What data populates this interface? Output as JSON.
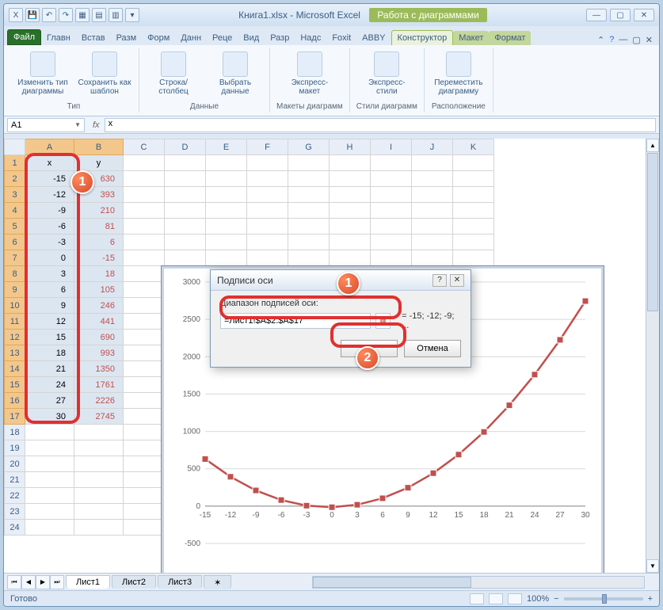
{
  "window": {
    "title": "Книга1.xlsx - Microsoft Excel",
    "chart_tools": "Работа с диаграммами"
  },
  "tabs": {
    "file": "Файл",
    "items": [
      "Главн",
      "Встав",
      "Разм",
      "Форм",
      "Данн",
      "Реце",
      "Вид",
      "Разр",
      "Надс",
      "Foxit",
      "ABBY"
    ],
    "ctx": [
      "Конструктор",
      "Макет",
      "Формат"
    ]
  },
  "ribbon": {
    "groups": [
      {
        "label": "Тип",
        "buttons": [
          "Изменить тип диаграммы",
          "Сохранить как шаблон"
        ]
      },
      {
        "label": "Данные",
        "buttons": [
          "Строка/столбец",
          "Выбрать данные"
        ]
      },
      {
        "label": "Макеты диаграмм",
        "buttons": [
          "Экспресс-макет"
        ]
      },
      {
        "label": "Стили диаграмм",
        "buttons": [
          "Экспресс-стили"
        ]
      },
      {
        "label": "Расположение",
        "buttons": [
          "Переместить диаграмму"
        ]
      }
    ]
  },
  "formula_bar": {
    "name_box": "A1",
    "fx_label": "fx",
    "value": "x"
  },
  "sheet": {
    "columns": [
      "A",
      "B",
      "C",
      "D",
      "E",
      "F",
      "G",
      "H",
      "I",
      "J",
      "K"
    ],
    "headers": {
      "A": "x",
      "B": "y"
    },
    "rows": [
      {
        "n": 1
      },
      {
        "n": 2,
        "A": -15,
        "B": 630
      },
      {
        "n": 3,
        "A": -12,
        "B": 393
      },
      {
        "n": 4,
        "A": -9,
        "B": 210
      },
      {
        "n": 5,
        "A": -6,
        "B": 81
      },
      {
        "n": 6,
        "A": -3,
        "B": 6
      },
      {
        "n": 7,
        "A": 0,
        "B": -15
      },
      {
        "n": 8,
        "A": 3,
        "B": 18
      },
      {
        "n": 9,
        "A": 6,
        "B": 105
      },
      {
        "n": 10,
        "A": 9,
        "B": 246
      },
      {
        "n": 11,
        "A": 12,
        "B": 441
      },
      {
        "n": 12,
        "A": 15,
        "B": 690
      },
      {
        "n": 13,
        "A": 18,
        "B": 993
      },
      {
        "n": 14,
        "A": 21,
        "B": 1350
      },
      {
        "n": 15,
        "A": 24,
        "B": 1761
      },
      {
        "n": 16,
        "A": 27,
        "B": 2226
      },
      {
        "n": 17,
        "A": 30,
        "B": 2745
      },
      {
        "n": 18
      },
      {
        "n": 19
      },
      {
        "n": 20
      },
      {
        "n": 21
      },
      {
        "n": 22
      },
      {
        "n": 23
      },
      {
        "n": 24
      }
    ]
  },
  "chart_data": {
    "type": "line",
    "x": [
      -15,
      -12,
      -9,
      -6,
      -3,
      0,
      3,
      6,
      9,
      12,
      15,
      18,
      21,
      24,
      27,
      30
    ],
    "y": [
      630,
      393,
      210,
      81,
      6,
      -15,
      18,
      105,
      246,
      441,
      690,
      993,
      1350,
      1761,
      2226,
      2745
    ],
    "xlim": [
      -15,
      30
    ],
    "ylim": [
      -500,
      3000
    ],
    "xstep": 3,
    "ystep": 500,
    "xlabel": "",
    "ylabel": "",
    "title": "",
    "series_color": "#c0504d"
  },
  "dialog": {
    "title": "Подписи оси",
    "label": "Диапазон подписей оси:",
    "input": "=Лист1!$A$2:$A$17",
    "preview": "= -15; -12; -9; ...",
    "ok": "ОК",
    "cancel": "Отмена"
  },
  "sheet_tabs": {
    "active": "Лист1",
    "others": [
      "Лист2",
      "Лист3"
    ]
  },
  "status": {
    "ready": "Готово",
    "zoom": "100%"
  },
  "callouts": {
    "b1": "1",
    "b1b": "1",
    "b2": "2"
  }
}
